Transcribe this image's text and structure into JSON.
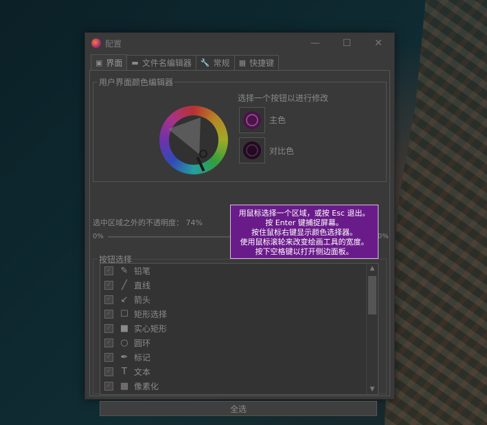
{
  "window": {
    "title": "配置",
    "controls": {
      "minimize": "—",
      "maximize": "☐",
      "close": "✕"
    }
  },
  "tabs": [
    {
      "label": "界面",
      "icon": "interface-icon",
      "active": true
    },
    {
      "label": "文件名编辑器",
      "icon": "filename-editor-icon",
      "active": false
    },
    {
      "label": "常规",
      "icon": "wrench-icon",
      "active": false
    },
    {
      "label": "快捷键",
      "icon": "grid-icon",
      "active": false
    }
  ],
  "color_editor": {
    "group_title": "用户界面颜色编辑器",
    "prompt": "选择一个按钮以进行修改",
    "main_color_label": "主色",
    "contrast_color_label": "对比色",
    "main_color": "#4a1448",
    "contrast_color": "#230a22"
  },
  "opacity": {
    "label": "选中区域之外的不透明度：",
    "value": "74%",
    "min_label": "0%",
    "max_label": "100%",
    "level_percent": 74
  },
  "buttons_selection": {
    "group_title": "按钮选择",
    "items": [
      {
        "label": "铅笔",
        "icon": "pencil-icon",
        "checked": true
      },
      {
        "label": "直线",
        "icon": "line-icon",
        "checked": true
      },
      {
        "label": "箭头",
        "icon": "arrow-icon",
        "checked": true
      },
      {
        "label": "矩形选择",
        "icon": "rectangle-select-icon",
        "checked": true
      },
      {
        "label": "实心矩形",
        "icon": "filled-rectangle-icon",
        "checked": true
      },
      {
        "label": "圆环",
        "icon": "circle-icon",
        "checked": true
      },
      {
        "label": "标记",
        "icon": "marker-icon",
        "checked": true
      },
      {
        "label": "文本",
        "icon": "text-icon",
        "checked": true
      },
      {
        "label": "像素化",
        "icon": "pixelate-icon",
        "checked": true
      }
    ],
    "select_all_label": "全选"
  },
  "tooltip": {
    "lines": [
      "用鼠标选择一个区域，或按 Esc 退出。",
      "按 Enter 键捕捉屏幕。",
      "按住鼠标右键显示颜色选择器。",
      "使用鼠标滚轮来改变绘画工具的宽度。",
      "按下空格键以打开侧边面板。"
    ],
    "background": "#6a1b8a"
  }
}
